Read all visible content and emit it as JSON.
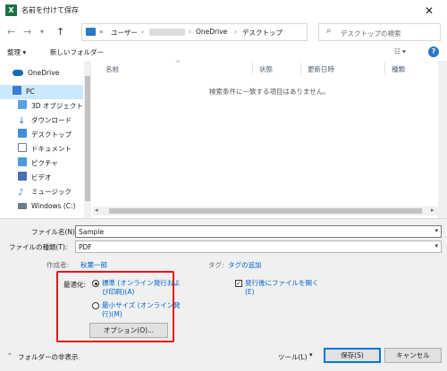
{
  "window": {
    "title": "名前を付けて保存",
    "app_icon_letter": "X",
    "close_glyph": "✕"
  },
  "address": {
    "back_glyph": "←",
    "forward_glyph": "→",
    "up_glyph": "↑",
    "overflow": "«",
    "user_segment": "ユーザー",
    "sep": "›",
    "onedrive": "OneDrive",
    "desktop": "デスクトップ",
    "refresh_glyph": "↻",
    "search_placeholder": "デスクトップの検索"
  },
  "toolbar": {
    "organize": "整理 ▾",
    "new_folder": "新しいフォルダー",
    "view_glyph": "☷ ▾",
    "help_glyph": "?"
  },
  "nav": {
    "items": [
      {
        "label": "OneDrive",
        "color": "#0f6cbd"
      },
      {
        "label": "PC",
        "color": "#3a7bd5"
      },
      {
        "label": "3D オブジェクト",
        "color": "#5aa2e6"
      },
      {
        "label": "ダウンロード",
        "color": "#2b78c5"
      },
      {
        "label": "デスクトップ",
        "color": "#3f8fdc"
      },
      {
        "label": "ドキュメント",
        "color": "#6f7f8f"
      },
      {
        "label": "ピクチャ",
        "color": "#4b9be0"
      },
      {
        "label": "ビデオ",
        "color": "#4b6fb5"
      },
      {
        "label": "ミュージック",
        "color": "#2f7ed8"
      },
      {
        "label": "Windows (C:)",
        "color": "#6b7a89"
      }
    ]
  },
  "list": {
    "columns": [
      "名前",
      "状態",
      "更新日時",
      "種類"
    ],
    "empty_message": "検索条件に一致する項目はありません。"
  },
  "form": {
    "filename_label": "ファイル名(N):",
    "filename_value": "Sample",
    "filetype_label": "ファイルの種類(T):",
    "filetype_value": "PDF",
    "author_label": "作成者:",
    "author_value": "秋葉一郎",
    "tags_label": "タグ:",
    "tags_value": "タグの追加",
    "optimize_label": "最適化:",
    "option_standard": "標準 (オンライン発行および印刷)(A)",
    "option_standard_l1": "標準 (オンライン発行およ",
    "option_standard_l2": "び印刷)(A)",
    "option_min_l1": "最小サイズ (オンライン発",
    "option_min_l2": "行)(M)",
    "options_button": "オプション(O)...",
    "open_after_l1": "発行後にファイルを開く",
    "open_after_l2": "(E)",
    "hide_folders": "フォルダーの非表示",
    "tools": "ツール(L)",
    "save": "保存(S)",
    "cancel": "キャンセル"
  },
  "colors": {
    "highlight": "#e8141b",
    "accent": "#0078d7",
    "link": "#0066cc"
  }
}
